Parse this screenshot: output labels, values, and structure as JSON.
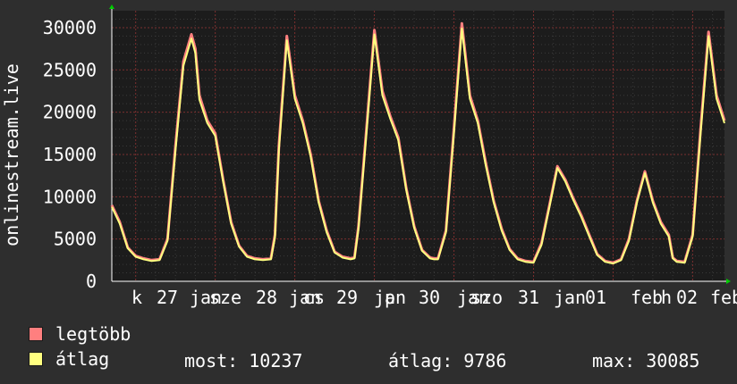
{
  "chart_data": {
    "type": "line",
    "ylabel": "onlinestream.live",
    "ylim": [
      0,
      32000
    ],
    "y_ticks": [
      0,
      5000,
      10000,
      15000,
      20000,
      25000,
      30000
    ],
    "grid": true,
    "x_tick_labels": [
      "k",
      "27",
      "jan",
      "sze",
      "28",
      "jan",
      "cs",
      "29",
      "jan",
      "p",
      "30",
      "jan",
      "szo",
      "31",
      "jan",
      "01",
      "feb",
      "h",
      "02",
      "feb"
    ],
    "x": [
      0,
      0.1,
      0.2,
      0.3,
      0.4,
      0.5,
      0.6,
      0.7,
      0.8,
      0.9,
      1.0,
      1.05,
      1.1,
      1.2,
      1.3,
      1.4,
      1.5,
      1.6,
      1.7,
      1.8,
      1.9,
      2.0,
      2.05,
      2.1,
      2.2,
      2.3,
      2.4,
      2.5,
      2.6,
      2.7,
      2.8,
      2.9,
      3.0,
      3.05,
      3.1,
      3.2,
      3.3,
      3.4,
      3.5,
      3.6,
      3.7,
      3.8,
      3.9,
      4.0,
      4.05,
      4.1,
      4.2,
      4.3,
      4.4,
      4.5,
      4.6,
      4.7,
      4.8,
      4.9,
      5.0,
      5.1,
      5.2,
      5.3,
      5.4,
      5.5,
      5.6,
      5.7,
      5.8,
      5.9,
      6.0,
      6.1,
      6.2,
      6.3,
      6.4,
      6.5,
      6.6,
      6.7,
      6.8,
      6.9,
      7.0,
      7.05,
      7.1,
      7.2,
      7.3,
      7.4,
      7.5,
      7.6,
      7.7
    ],
    "series": [
      {
        "name": "legtöbb",
        "color": "#ff7f7f",
        "values": [
          9000,
          7000,
          4000,
          3000,
          2700,
          2500,
          2600,
          5000,
          16000,
          26000,
          29200,
          27500,
          22000,
          19000,
          17500,
          12000,
          7000,
          4200,
          3000,
          2700,
          2600,
          2700,
          5500,
          16000,
          29000,
          22000,
          19000,
          15000,
          9500,
          6000,
          3500,
          2900,
          2700,
          2800,
          6500,
          18000,
          29700,
          22500,
          19500,
          17000,
          11000,
          6500,
          3700,
          2800,
          2700,
          2700,
          6000,
          18000,
          30500,
          22000,
          19000,
          14000,
          9500,
          6200,
          3800,
          2700,
          2400,
          2300,
          4500,
          9000,
          13600,
          12000,
          9800,
          7800,
          5500,
          3200,
          2400,
          2200,
          2600,
          5000,
          9500,
          13000,
          9500,
          7000,
          5500,
          2800,
          2400,
          2300,
          5500,
          18000,
          29500,
          22000,
          19000
        ]
      },
      {
        "name": "átlag",
        "color": "#ffff80",
        "values": [
          8800,
          6800,
          3900,
          2900,
          2600,
          2400,
          2500,
          4800,
          15500,
          25500,
          28700,
          27000,
          21500,
          18700,
          17200,
          11800,
          6800,
          4100,
          2900,
          2600,
          2500,
          2600,
          5200,
          15500,
          28500,
          21600,
          18700,
          14700,
          9300,
          5800,
          3400,
          2800,
          2600,
          2700,
          6200,
          17500,
          29200,
          22000,
          19200,
          16700,
          10800,
          6300,
          3600,
          2700,
          2600,
          2600,
          5800,
          17500,
          29900,
          21600,
          18700,
          13700,
          9300,
          6000,
          3700,
          2600,
          2300,
          2200,
          4300,
          8800,
          13400,
          11800,
          9600,
          7600,
          5300,
          3100,
          2300,
          2100,
          2500,
          4800,
          9300,
          12800,
          9300,
          6800,
          5300,
          2700,
          2300,
          2200,
          5300,
          17500,
          29000,
          21600,
          18700
        ]
      }
    ],
    "stats": {
      "most_label": "most:",
      "most_value": "10237",
      "atlag_label": "átlag:",
      "atlag_value": "9786",
      "max_label": "max:",
      "max_value": "30085"
    }
  },
  "colors": {
    "background": "#2e2e2e",
    "plot_bg": "#1c1c1c",
    "grid_major": "#7a2f2f",
    "axis": "#ffffff",
    "arrow": "#00cc00"
  }
}
